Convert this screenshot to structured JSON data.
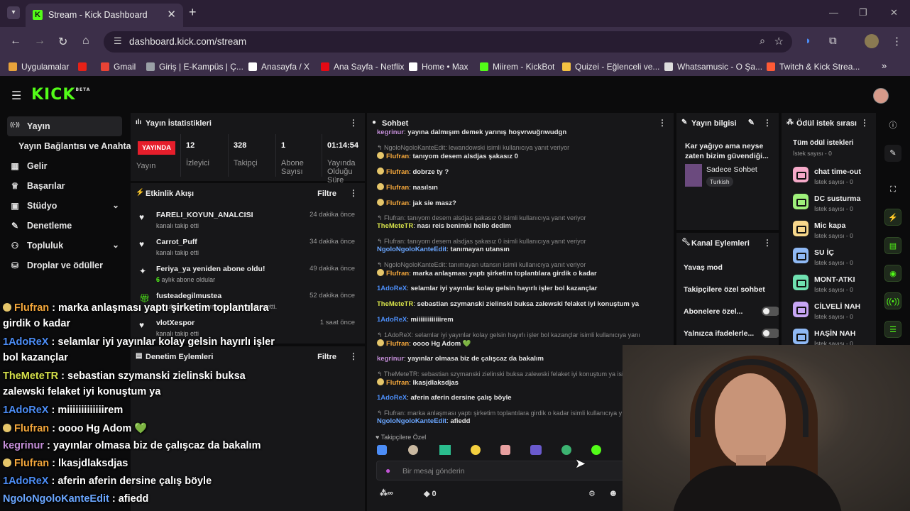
{
  "browser": {
    "tab_title": "Stream - Kick Dashboard",
    "url": "dashboard.kick.com/stream",
    "bookmarks": [
      {
        "label": "Uygulamalar",
        "color": "#e8a33b"
      },
      {
        "label": "",
        "color": "#e62117"
      },
      {
        "label": "Gmail",
        "color": "#ea4335"
      },
      {
        "label": "Giriş | E-Kampüs | Ç...",
        "color": "#9aa0a6"
      },
      {
        "label": "Anasayfa / X",
        "color": "#ffffff"
      },
      {
        "label": "Ana Sayfa - Netflix",
        "color": "#e50914"
      },
      {
        "label": "Home • Max",
        "color": "#ffffff"
      },
      {
        "label": "Miirem - KickBot",
        "color": "#53fc18"
      },
      {
        "label": "Quizei - Eğlenceli ve...",
        "color": "#f5c242"
      },
      {
        "label": "Whatsamusic - O Şa...",
        "color": "#dddddd"
      },
      {
        "label": "Twitch & Kick Strea...",
        "color": "#ff5a36"
      }
    ]
  },
  "kick": {
    "logo": "KICK",
    "logo_sup": "BETA"
  },
  "sidebar": {
    "items": [
      {
        "label": "Yayın",
        "icon": "broadcast-icon"
      },
      {
        "label": "Yayın Bağlantısı ve Anahtarı",
        "icon": ""
      },
      {
        "label": "Gelir",
        "icon": "revenue-icon"
      },
      {
        "label": "Başarılar",
        "icon": "trophy-icon"
      },
      {
        "label": "Stüdyo",
        "icon": "studio-icon"
      },
      {
        "label": "Denetleme",
        "icon": "wrench-icon"
      },
      {
        "label": "Topluluk",
        "icon": "community-icon"
      },
      {
        "label": "Droplar ve ödüller",
        "icon": "drops-icon"
      }
    ]
  },
  "stats": {
    "title": "Yayın İstatistikleri",
    "live_badge": "YAYINDA",
    "live_label": "Yayın",
    "items": [
      {
        "value": "12",
        "label": "İzleyici"
      },
      {
        "value": "328",
        "label": "Takipçi"
      },
      {
        "value": "1",
        "label": "Abone Sayısı"
      },
      {
        "value": "01:14:54",
        "label": "Yayında Olduğu Süre"
      }
    ]
  },
  "activity": {
    "title": "Etkinlik Akışı",
    "filter": "Filtre",
    "items": [
      {
        "name": "FARELI_KOYUN_ANALCISI",
        "sub": "kanalı takip etti",
        "time": "24 dakika önce",
        "icon": "heart-icon"
      },
      {
        "name": "Carrot_Puff",
        "sub": "kanalı takip etti",
        "time": "34 dakika önce",
        "icon": "heart-icon"
      },
      {
        "name": "Feriya_ya yeniden abone oldu!",
        "sub_bold": "6",
        "sub": "aylık abone oldular",
        "time": "49 dakika önce",
        "icon": "sparkle-icon"
      },
      {
        "name": "fusteadegilmustea",
        "sub": "1 Flufran kullanıcısına abonelik hediye etti.",
        "time": "52 dakika önce",
        "icon": "gift-icon"
      },
      {
        "name": "vlotXespor",
        "sub": "kanalı takip etti",
        "time": "1 saat önce",
        "icon": "heart-icon"
      }
    ]
  },
  "moderation": {
    "title": "Denetim Eylemleri",
    "filter": "Filtre"
  },
  "chat": {
    "title": "Sohbet",
    "messages": [
      {
        "type": "msg",
        "user": "kegrinur",
        "color": "c-pk",
        "text": "yayına dalmışım demek yarınış hoşvrwuğrıwudgn"
      },
      {
        "type": "reply",
        "text": "NgoloNgoloKanteEdit: lewandowski isimli kullanıcıya yanıt veriyor"
      },
      {
        "type": "msg",
        "user": "Flufran",
        "color": "c-or",
        "emote": true,
        "text": "tanıyom desem alsdjas şakasız 0"
      },
      {
        "type": "msg",
        "user": "Flufran",
        "color": "c-or",
        "emote": true,
        "text": "dobrze ty ?"
      },
      {
        "type": "msg",
        "user": "Flufran",
        "color": "c-or",
        "emote": true,
        "text": "nasılsın"
      },
      {
        "type": "msg",
        "user": "Flufran",
        "color": "c-or",
        "emote": true,
        "text": "jak sie masz?"
      },
      {
        "type": "reply",
        "text": "Flufran: tanıyom desem alsdjas şakasız 0 isimli kullanıcıya yanıt veriyor"
      },
      {
        "type": "msg",
        "user": "TheMeteTR",
        "color": "c-yl",
        "text": "nası reis benimki hello dedim"
      },
      {
        "type": "reply",
        "text": "Flufran: tanıyom desem alsdjas şakasız 0 isimli kullanıcıya yanıt veriyor"
      },
      {
        "type": "msg",
        "user": "NgoloNgoloKanteEdit",
        "color": "c-lb",
        "text": "tanımayan utansın"
      },
      {
        "type": "reply",
        "text": "NgoloNgoloKanteEdit: tanımayan utansın isimli kullanıcıya yanıt veriyor"
      },
      {
        "type": "msg",
        "user": "Flufran",
        "color": "c-or",
        "emote": true,
        "text": "marka anlaşması yaptı şirketim toplantılara girdik o kadar"
      },
      {
        "type": "msg",
        "user": "1AdoReX",
        "color": "c-bl",
        "text": "selamlar iyi yayınlar kolay gelsin hayırlı işler bol kazançlar"
      },
      {
        "type": "msg",
        "user": "TheMeteTR",
        "color": "c-yl",
        "text": "sebastian szymanski zielinski buksa zalewski felaket iyi konuştum ya"
      },
      {
        "type": "msg",
        "user": "1AdoReX",
        "color": "c-bl",
        "text": "miiiiiiiiiiiiirem"
      },
      {
        "type": "reply",
        "text": "1AdoReX: selamlar iyi yayınlar kolay gelsin hayırlı işler bol kazançlar isimli kullanıcıya yanıt veriyor"
      },
      {
        "type": "msg",
        "user": "Flufran",
        "color": "c-or",
        "emote": true,
        "text": "oooo Hg Adom 💚"
      },
      {
        "type": "msg",
        "user": "kegrinur",
        "color": "c-pk",
        "text": "yayınlar olmasa biz de çalışcaz da bakalım"
      },
      {
        "type": "reply",
        "text": "TheMeteTR: sebastian szymanski zielinski buksa zalewski felaket iyi konuştum ya isi"
      },
      {
        "type": "msg",
        "user": "Flufran",
        "color": "c-or",
        "emote": true,
        "text": "lkasjdlaksdjas"
      },
      {
        "type": "msg",
        "user": "1AdoReX",
        "color": "c-bl",
        "text": "aferin aferin dersine çalış böyle"
      },
      {
        "type": "reply",
        "text": "Flufran: marka anlaşması yaptı şirketim toplantılara girdik o kadar isimli kullanıcıya y"
      },
      {
        "type": "msg",
        "user": "NgoloNgoloKanteEdit",
        "color": "c-lb",
        "text": "afiedd"
      }
    ],
    "followers_only": "Takipçilere Özel",
    "input_placeholder": "Bir mesaj gönderin",
    "counter": "0"
  },
  "stream_info": {
    "title": "Yayın bilgisi",
    "stream_title": "Kar yağıyo ama neyse zaten bizim güvendiği...",
    "category": "Sadece Sohbet",
    "language": "Turkish"
  },
  "channel_actions": {
    "title": "Kanal Eylemleri",
    "items": [
      {
        "label": "Yavaş mod",
        "kind": "arrow"
      },
      {
        "label": "Takipçilere özel sohbet",
        "kind": "arrow"
      },
      {
        "label": "Abonelere özel...",
        "kind": "toggle"
      },
      {
        "label": "Yalnızca ifadelerle...",
        "kind": "toggle"
      }
    ]
  },
  "rewards": {
    "title": "Ödül istek sırası",
    "all_title": "Tüm ödül istekleri",
    "all_sub": "İstek sayısı - 0",
    "items": [
      {
        "name": "chat time-out",
        "sub": "İstek sayısı - 0",
        "color": "#f5a9c8"
      },
      {
        "name": "DC susturma",
        "sub": "İstek sayısı - 0",
        "color": "#9ef07a"
      },
      {
        "name": "Mic kapa",
        "sub": "İstek sayısı - 0",
        "color": "#f7d78b"
      },
      {
        "name": "SU İÇ",
        "sub": "İstek sayısı - 0",
        "color": "#8fb9f5"
      },
      {
        "name": "MONT-ATKI",
        "sub": "İstek sayısı - 0",
        "color": "#6fe0b0"
      },
      {
        "name": "CİLVELİ NAH",
        "sub": "İstek sayısı - 0",
        "color": "#c7a6f5"
      },
      {
        "name": "HAŞİN NAH",
        "sub": "İstek sayısı - 0",
        "color": "#8fb9f5"
      }
    ]
  },
  "overlay": [
    {
      "user": "Flufran",
      "color": "c-or",
      "emote": true,
      "text": "marka anlaşması yaptı şirketim toplantılara",
      "line2": "girdik o kadar"
    },
    {
      "user": "1AdoReX",
      "color": "c-bl",
      "text": "selamlar iyi yayınlar kolay gelsin hayırlı işler",
      "line2": "bol kazançlar"
    },
    {
      "user": "TheMeteTR",
      "color": "c-yl",
      "text": "sebastian szymanski zielinski buksa",
      "line2": "zalewski felaket iyi konuştum ya"
    },
    {
      "user": "1AdoReX",
      "color": "c-bl",
      "text": "miiiiiiiiiiiiirem"
    },
    {
      "user": "Flufran",
      "color": "c-or",
      "emote": true,
      "text": "oooo Hg Adom 💚"
    },
    {
      "user": "kegrinur",
      "color": "c-pk",
      "text": "yayınlar olmasa biz de çalışcaz da bakalım"
    },
    {
      "user": "Flufran",
      "color": "c-or",
      "emote": true,
      "text": "lkasjdlaksdjas"
    },
    {
      "user": "1AdoReX",
      "color": "c-bl",
      "text": "aferin aferin dersine çalış böyle"
    },
    {
      "user": "NgoloNgoloKanteEdit",
      "color": "c-lb",
      "text": "afiedd"
    }
  ]
}
